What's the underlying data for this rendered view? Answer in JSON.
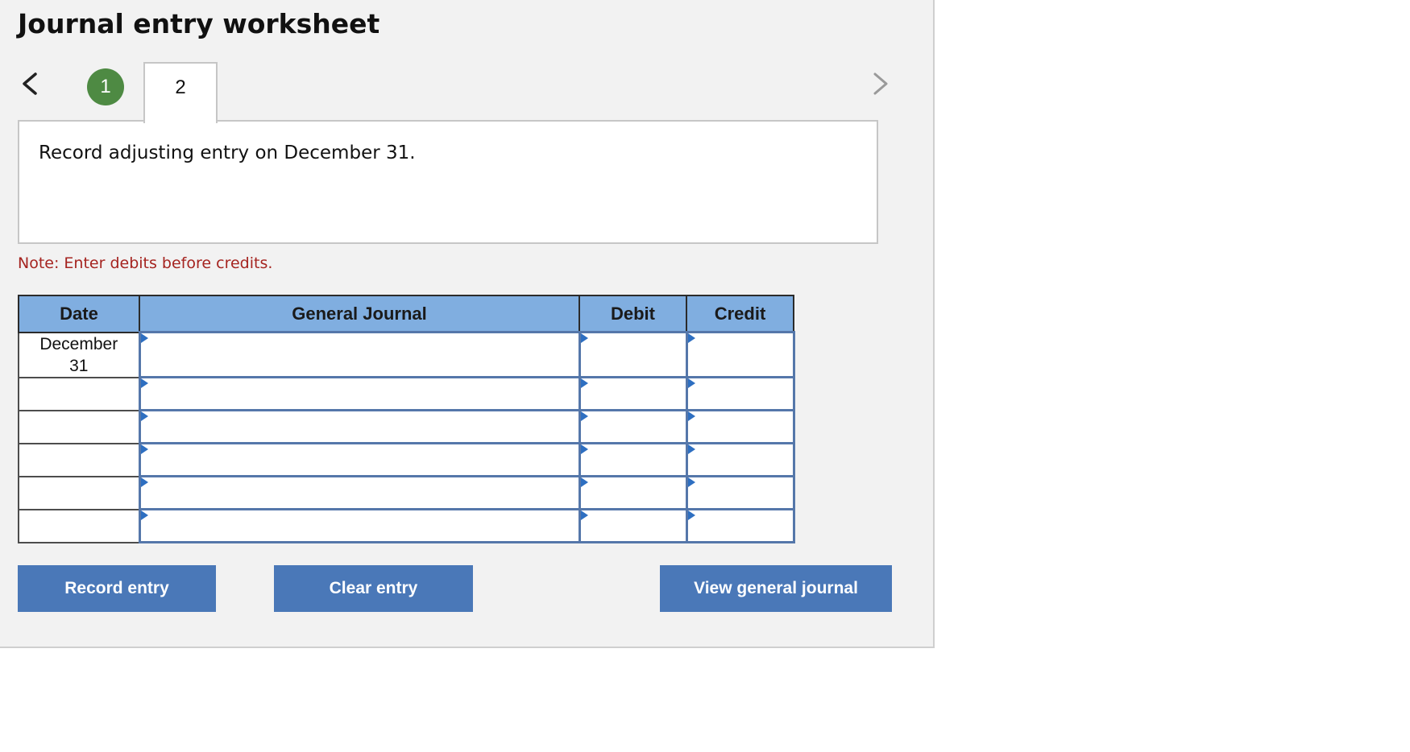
{
  "header": {
    "title": "Journal entry worksheet"
  },
  "steps": {
    "completed_label": "1",
    "current_label": "2"
  },
  "instruction": {
    "text": "Record adjusting entry on December 31."
  },
  "note": {
    "text": "Note: Enter debits before credits."
  },
  "table": {
    "columns": {
      "date": "Date",
      "general_journal": "General Journal",
      "debit": "Debit",
      "credit": "Credit"
    },
    "rows": [
      {
        "date_line1": "December",
        "date_line2": "31",
        "account": "",
        "debit": "",
        "credit": ""
      },
      {
        "date_line1": "",
        "date_line2": "",
        "account": "",
        "debit": "",
        "credit": ""
      },
      {
        "date_line1": "",
        "date_line2": "",
        "account": "",
        "debit": "",
        "credit": ""
      },
      {
        "date_line1": "",
        "date_line2": "",
        "account": "",
        "debit": "",
        "credit": ""
      },
      {
        "date_line1": "",
        "date_line2": "",
        "account": "",
        "debit": "",
        "credit": ""
      },
      {
        "date_line1": "",
        "date_line2": "",
        "account": "",
        "debit": "",
        "credit": ""
      }
    ]
  },
  "buttons": {
    "record": "Record entry",
    "clear": "Clear entry",
    "view_journal": "View general journal"
  },
  "colors": {
    "step_complete": "#4e8a43",
    "header_fill": "#80aee0",
    "button_fill": "#4a78b8",
    "note_text": "#a52420",
    "input_border": "#5577aa"
  },
  "icons": {
    "prev": "chevron-left-icon",
    "next": "chevron-right-icon",
    "dropdown": "dropdown-marker-icon"
  }
}
